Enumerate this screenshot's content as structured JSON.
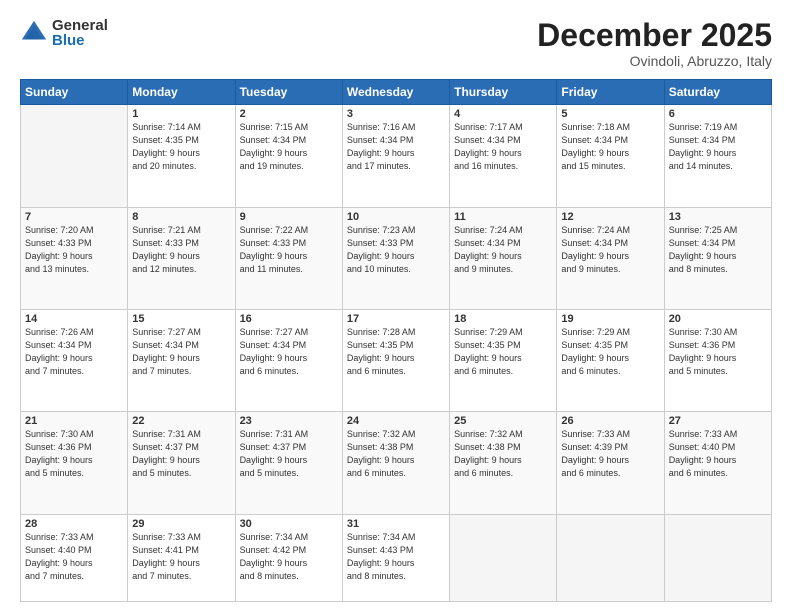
{
  "logo": {
    "general": "General",
    "blue": "Blue"
  },
  "title": {
    "month": "December 2025",
    "location": "Ovindoli, Abruzzo, Italy"
  },
  "weekdays": [
    "Sunday",
    "Monday",
    "Tuesday",
    "Wednesday",
    "Thursday",
    "Friday",
    "Saturday"
  ],
  "weeks": [
    [
      {
        "day": "",
        "info": ""
      },
      {
        "day": "1",
        "info": "Sunrise: 7:14 AM\nSunset: 4:35 PM\nDaylight: 9 hours\nand 20 minutes."
      },
      {
        "day": "2",
        "info": "Sunrise: 7:15 AM\nSunset: 4:34 PM\nDaylight: 9 hours\nand 19 minutes."
      },
      {
        "day": "3",
        "info": "Sunrise: 7:16 AM\nSunset: 4:34 PM\nDaylight: 9 hours\nand 17 minutes."
      },
      {
        "day": "4",
        "info": "Sunrise: 7:17 AM\nSunset: 4:34 PM\nDaylight: 9 hours\nand 16 minutes."
      },
      {
        "day": "5",
        "info": "Sunrise: 7:18 AM\nSunset: 4:34 PM\nDaylight: 9 hours\nand 15 minutes."
      },
      {
        "day": "6",
        "info": "Sunrise: 7:19 AM\nSunset: 4:34 PM\nDaylight: 9 hours\nand 14 minutes."
      }
    ],
    [
      {
        "day": "7",
        "info": "Sunrise: 7:20 AM\nSunset: 4:33 PM\nDaylight: 9 hours\nand 13 minutes."
      },
      {
        "day": "8",
        "info": "Sunrise: 7:21 AM\nSunset: 4:33 PM\nDaylight: 9 hours\nand 12 minutes."
      },
      {
        "day": "9",
        "info": "Sunrise: 7:22 AM\nSunset: 4:33 PM\nDaylight: 9 hours\nand 11 minutes."
      },
      {
        "day": "10",
        "info": "Sunrise: 7:23 AM\nSunset: 4:33 PM\nDaylight: 9 hours\nand 10 minutes."
      },
      {
        "day": "11",
        "info": "Sunrise: 7:24 AM\nSunset: 4:34 PM\nDaylight: 9 hours\nand 9 minutes."
      },
      {
        "day": "12",
        "info": "Sunrise: 7:24 AM\nSunset: 4:34 PM\nDaylight: 9 hours\nand 9 minutes."
      },
      {
        "day": "13",
        "info": "Sunrise: 7:25 AM\nSunset: 4:34 PM\nDaylight: 9 hours\nand 8 minutes."
      }
    ],
    [
      {
        "day": "14",
        "info": "Sunrise: 7:26 AM\nSunset: 4:34 PM\nDaylight: 9 hours\nand 7 minutes."
      },
      {
        "day": "15",
        "info": "Sunrise: 7:27 AM\nSunset: 4:34 PM\nDaylight: 9 hours\nand 7 minutes."
      },
      {
        "day": "16",
        "info": "Sunrise: 7:27 AM\nSunset: 4:34 PM\nDaylight: 9 hours\nand 6 minutes."
      },
      {
        "day": "17",
        "info": "Sunrise: 7:28 AM\nSunset: 4:35 PM\nDaylight: 9 hours\nand 6 minutes."
      },
      {
        "day": "18",
        "info": "Sunrise: 7:29 AM\nSunset: 4:35 PM\nDaylight: 9 hours\nand 6 minutes."
      },
      {
        "day": "19",
        "info": "Sunrise: 7:29 AM\nSunset: 4:35 PM\nDaylight: 9 hours\nand 6 minutes."
      },
      {
        "day": "20",
        "info": "Sunrise: 7:30 AM\nSunset: 4:36 PM\nDaylight: 9 hours\nand 5 minutes."
      }
    ],
    [
      {
        "day": "21",
        "info": "Sunrise: 7:30 AM\nSunset: 4:36 PM\nDaylight: 9 hours\nand 5 minutes."
      },
      {
        "day": "22",
        "info": "Sunrise: 7:31 AM\nSunset: 4:37 PM\nDaylight: 9 hours\nand 5 minutes."
      },
      {
        "day": "23",
        "info": "Sunrise: 7:31 AM\nSunset: 4:37 PM\nDaylight: 9 hours\nand 5 minutes."
      },
      {
        "day": "24",
        "info": "Sunrise: 7:32 AM\nSunset: 4:38 PM\nDaylight: 9 hours\nand 6 minutes."
      },
      {
        "day": "25",
        "info": "Sunrise: 7:32 AM\nSunset: 4:38 PM\nDaylight: 9 hours\nand 6 minutes."
      },
      {
        "day": "26",
        "info": "Sunrise: 7:33 AM\nSunset: 4:39 PM\nDaylight: 9 hours\nand 6 minutes."
      },
      {
        "day": "27",
        "info": "Sunrise: 7:33 AM\nSunset: 4:40 PM\nDaylight: 9 hours\nand 6 minutes."
      }
    ],
    [
      {
        "day": "28",
        "info": "Sunrise: 7:33 AM\nSunset: 4:40 PM\nDaylight: 9 hours\nand 7 minutes."
      },
      {
        "day": "29",
        "info": "Sunrise: 7:33 AM\nSunset: 4:41 PM\nDaylight: 9 hours\nand 7 minutes."
      },
      {
        "day": "30",
        "info": "Sunrise: 7:34 AM\nSunset: 4:42 PM\nDaylight: 9 hours\nand 8 minutes."
      },
      {
        "day": "31",
        "info": "Sunrise: 7:34 AM\nSunset: 4:43 PM\nDaylight: 9 hours\nand 8 minutes."
      },
      {
        "day": "",
        "info": ""
      },
      {
        "day": "",
        "info": ""
      },
      {
        "day": "",
        "info": ""
      }
    ]
  ]
}
